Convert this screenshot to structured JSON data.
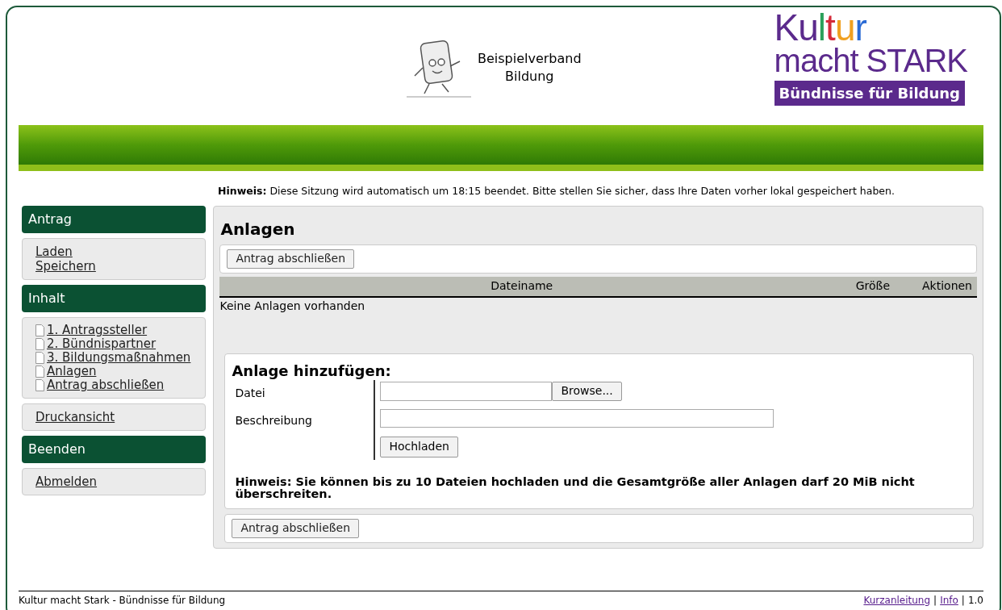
{
  "header": {
    "org_lines": [
      "Beispielverband",
      "Bildung"
    ],
    "logo": {
      "line1": "Kultur",
      "line2": "macht STARK",
      "tagline": "Bündnisse für Bildung"
    }
  },
  "notice": "**Hinweis:** Diese Sitzung wird automatisch um 18:15 beendet. Bitte stellen Sie sicher, dass Ihre Daten vorher lokal gespeichert haben.",
  "sidebar": [
    {
      "kind": "heading",
      "title": "Antrag"
    },
    {
      "kind": "links",
      "links": [
        {
          "label": "Laden",
          "kind": "plain"
        },
        {
          "label": "Speichern",
          "kind": "plain"
        }
      ]
    },
    {
      "kind": "heading",
      "title": "Inhalt"
    },
    {
      "kind": "links",
      "links": [
        {
          "label": "1. Antragssteller",
          "kind": "page"
        },
        {
          "label": "2. Bündnispartner",
          "kind": "page"
        },
        {
          "label": "3. Bildungsmaßnahmen",
          "kind": "page"
        },
        {
          "label": "Anlagen",
          "kind": "page"
        },
        {
          "label": "Antrag abschließen",
          "kind": "page"
        }
      ]
    },
    {
      "kind": "links",
      "links": [
        {
          "label": "Druckansicht",
          "kind": "plain"
        }
      ]
    },
    {
      "kind": "heading",
      "title": "Beenden"
    },
    {
      "kind": "links",
      "links": [
        {
          "label": "Abmelden",
          "kind": "plain"
        }
      ]
    }
  ],
  "main": {
    "title": "Anlagen",
    "top_button": "Antrag abschließen",
    "table": {
      "columns": [
        "Dateiname",
        "Größe",
        "Aktionen"
      ],
      "empty_text": "Keine Anlagen vorhanden"
    },
    "form": {
      "title": "Anlage hinzufügen:",
      "fields": [
        {
          "label": "Datei",
          "kind": "file",
          "button": "Browse..."
        },
        {
          "label": "Beschreibung",
          "kind": "text"
        }
      ],
      "submit": "Hochladen",
      "hint": "Hinweis: Sie können bis zu 10 Dateien hochladen und die Gesamtgröße aller Anlagen darf 20 MiB nicht überschreiten."
    },
    "bottom_button": "Antrag abschließen"
  },
  "footer": {
    "left": "Kultur macht Stark - Bündnisse für Bildung",
    "right": [
      {
        "kind": "link",
        "text": "Kurzanleitung"
      },
      {
        "kind": "text",
        "text": "|"
      },
      {
        "kind": "link",
        "text": "Info"
      },
      {
        "kind": "text",
        "text": "|"
      },
      {
        "kind": "text",
        "text": "1.0"
      }
    ]
  }
}
